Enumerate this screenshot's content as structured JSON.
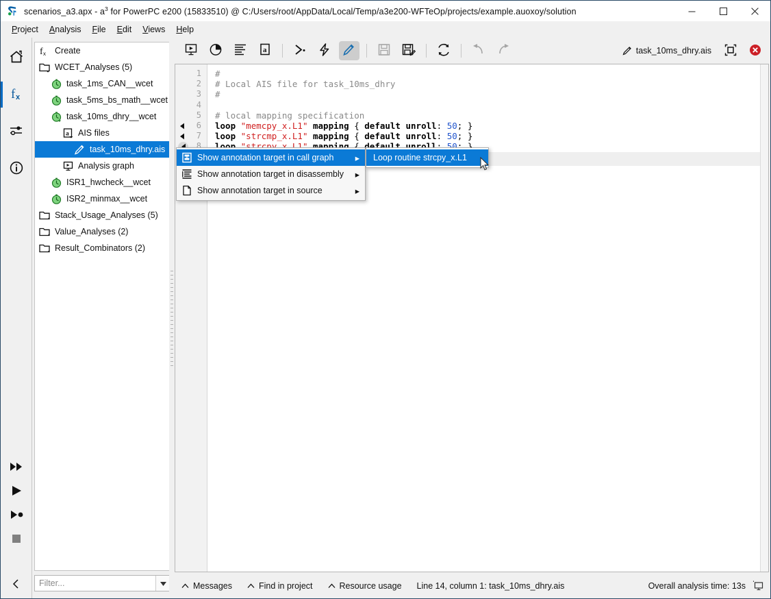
{
  "window": {
    "title_prefix": "scenarios_a3.apx - a",
    "title_sup": "3",
    "title_rest": " for PowerPC e200 (15833510) @ C:/Users/root/AppData/Local/Temp/a3e200-WFTeOp/projects/example.auoxoy/solution",
    "app_icon": "a3-app-icon",
    "minimize_label": "─",
    "maximize_label": "□",
    "close_label": "✕"
  },
  "menubar": {
    "items": [
      {
        "label": "Project",
        "mnemonic": "P"
      },
      {
        "label": "Analysis",
        "mnemonic": "A"
      },
      {
        "label": "File",
        "mnemonic": "F"
      },
      {
        "label": "Edit",
        "mnemonic": "E"
      },
      {
        "label": "Views",
        "mnemonic": "V"
      },
      {
        "label": "Help",
        "mnemonic": "H"
      }
    ]
  },
  "rail": {
    "items": [
      {
        "name": "home-icon",
        "active": false
      },
      {
        "name": "fx-analyses-icon",
        "active": true
      },
      {
        "name": "sliders-settings-icon",
        "active": false
      },
      {
        "name": "info-circle-icon",
        "active": false
      }
    ],
    "bottom_items": [
      {
        "name": "fast-forward-icon"
      },
      {
        "name": "play-icon"
      },
      {
        "name": "play-to-cursor-icon"
      },
      {
        "name": "stop-icon"
      },
      {
        "name": "collapse-left-icon"
      }
    ]
  },
  "sidebar": {
    "tree": [
      {
        "label": "Create",
        "icon": "fx-create-icon",
        "indent": 0,
        "selected": false
      },
      {
        "label": "WCET_Analyses (5)",
        "icon": "folder-open-icon",
        "indent": 0,
        "selected": false
      },
      {
        "label": "task_1ms_CAN__wcet",
        "icon": "clock-green-icon",
        "indent": 1,
        "selected": false
      },
      {
        "label": "task_5ms_bs_math__wcet",
        "icon": "clock-green-icon",
        "indent": 1,
        "selected": false
      },
      {
        "label": "task_10ms_dhry__wcet",
        "icon": "clock-green-open-icon",
        "indent": 1,
        "selected": false
      },
      {
        "label": "AIS files",
        "icon": "ais-file-icon",
        "indent": 2,
        "selected": false
      },
      {
        "label": "task_10ms_dhry.ais",
        "icon": "pencil-icon",
        "indent": 3,
        "selected": true
      },
      {
        "label": "Analysis graph",
        "icon": "analysis-graph-icon",
        "indent": 2,
        "selected": false
      },
      {
        "label": "ISR1_hwcheck__wcet",
        "icon": "clock-green-icon",
        "indent": 1,
        "selected": false
      },
      {
        "label": "ISR2_minmax__wcet",
        "icon": "clock-green-icon",
        "indent": 1,
        "selected": false
      },
      {
        "label": "Stack_Usage_Analyses (5)",
        "icon": "folder-icon",
        "indent": 0,
        "selected": false
      },
      {
        "label": "Value_Analyses (2)",
        "icon": "folder-icon",
        "indent": 0,
        "selected": false
      },
      {
        "label": "Result_Combinators (2)",
        "icon": "folder-icon",
        "indent": 0,
        "selected": false
      }
    ],
    "filter": {
      "value": "",
      "placeholder": "Filter...",
      "dropdown_icon": "chevron-down-icon"
    }
  },
  "toolbar": {
    "buttons": [
      {
        "name": "analysis-graph-button",
        "icon": "monitor-play-icon",
        "state": "normal"
      },
      {
        "name": "pie-report-button",
        "icon": "pie-chart-icon",
        "state": "normal"
      },
      {
        "name": "report-button",
        "icon": "text-lines-icon",
        "state": "normal"
      },
      {
        "name": "ais-file-button",
        "icon": "a-document-icon",
        "state": "normal"
      },
      {
        "name": "separator-1",
        "icon": "separator",
        "state": "sep"
      },
      {
        "name": "run-batch-button",
        "icon": "chevron-prompt-icon",
        "state": "normal"
      },
      {
        "name": "quick-analysis-button",
        "icon": "lightning-icon",
        "state": "normal"
      },
      {
        "name": "edit-annotations-button",
        "icon": "pencil-icon",
        "state": "active"
      },
      {
        "name": "separator-2",
        "icon": "separator",
        "state": "sep"
      },
      {
        "name": "save-button",
        "icon": "floppy-icon",
        "state": "disabled"
      },
      {
        "name": "save-as-button",
        "icon": "floppy-pencil-icon",
        "state": "normal"
      },
      {
        "name": "separator-3",
        "icon": "separator",
        "state": "sep"
      },
      {
        "name": "refresh-button",
        "icon": "refresh-icon",
        "state": "normal"
      },
      {
        "name": "separator-4",
        "icon": "separator",
        "state": "sep"
      },
      {
        "name": "undo-button",
        "icon": "undo-icon",
        "state": "disabled"
      },
      {
        "name": "redo-button",
        "icon": "redo-icon",
        "state": "disabled"
      }
    ],
    "document_label": "task_10ms_dhry.ais",
    "document_icon": "pencil-icon",
    "detach_icon": "detach-view-icon",
    "close_icon": "close-red-icon"
  },
  "editor": {
    "lines": [
      {
        "num": "1",
        "fold": "",
        "tokens": [
          {
            "t": "#",
            "c": "cm"
          }
        ]
      },
      {
        "num": "2",
        "fold": "",
        "tokens": [
          {
            "t": "# Local AIS file for task_10ms_dhry",
            "c": "cm"
          }
        ]
      },
      {
        "num": "3",
        "fold": "",
        "tokens": [
          {
            "t": "#",
            "c": "cm"
          }
        ]
      },
      {
        "num": "4",
        "fold": "",
        "tokens": []
      },
      {
        "num": "5",
        "fold": "",
        "tokens": [
          {
            "t": "# local mapping specification",
            "c": "cm"
          }
        ]
      },
      {
        "num": "6",
        "fold": "tri",
        "tokens": [
          {
            "t": "loop ",
            "c": "kw"
          },
          {
            "t": "\"memcpy_x.L1\"",
            "c": "str"
          },
          {
            "t": " mapping ",
            "c": "kw"
          },
          {
            "t": "{ ",
            "c": "pl"
          },
          {
            "t": "default unroll",
            "c": "kw"
          },
          {
            "t": ": ",
            "c": "pl"
          },
          {
            "t": "50",
            "c": "num"
          },
          {
            "t": "; }",
            "c": "pl"
          }
        ]
      },
      {
        "num": "7",
        "fold": "tri",
        "tokens": [
          {
            "t": "loop ",
            "c": "kw"
          },
          {
            "t": "\"strcmp_x.L1\"",
            "c": "str"
          },
          {
            "t": " mapping ",
            "c": "kw"
          },
          {
            "t": "{ ",
            "c": "pl"
          },
          {
            "t": "default unroll",
            "c": "kw"
          },
          {
            "t": ": ",
            "c": "pl"
          },
          {
            "t": "50",
            "c": "num"
          },
          {
            "t": "; }",
            "c": "pl"
          }
        ]
      },
      {
        "num": "8",
        "fold": "circ",
        "tokens": [
          {
            "t": "loop ",
            "c": "kw"
          },
          {
            "t": "\"strcpy_x.L1\"",
            "c": "str"
          },
          {
            "t": " mapping ",
            "c": "kw"
          },
          {
            "t": "{ ",
            "c": "pl"
          },
          {
            "t": "default unroll",
            "c": "kw"
          },
          {
            "t": ": ",
            "c": "pl"
          },
          {
            "t": "50",
            "c": "num"
          },
          {
            "t": "; }",
            "c": "pl"
          }
        ]
      }
    ],
    "current_line_index": 8
  },
  "context_menu": {
    "items": [
      {
        "label": "Show annotation target in call graph",
        "icon": "call-graph-icon",
        "arrow": "▸",
        "highlighted": true
      },
      {
        "label": "Show annotation target in disassembly",
        "icon": "disassembly-lines-icon",
        "arrow": "▸",
        "highlighted": false
      },
      {
        "label": "Show annotation target in source",
        "icon": "source-file-icon",
        "arrow": "▸",
        "highlighted": false
      }
    ],
    "submenu": [
      {
        "label": "Loop routine strcpy_x.L1",
        "highlighted": true
      }
    ]
  },
  "statusbar": {
    "items": [
      {
        "label": "Messages",
        "caret": "∧"
      },
      {
        "label": "Find in project",
        "caret": "∧"
      },
      {
        "label": "Resource usage",
        "caret": "∧"
      }
    ],
    "position": "Line 14, column 1: task_10ms_dhry.ais",
    "analysis_time": "Overall analysis time: 13s",
    "right_icon": "monitor-icon"
  },
  "colors": {
    "accent": "#0b7ad6",
    "rail_active": "#0a6cc4",
    "window_border": "#2a4a66",
    "chrome": "#f0f0f0",
    "close_red": "#cc2027"
  }
}
